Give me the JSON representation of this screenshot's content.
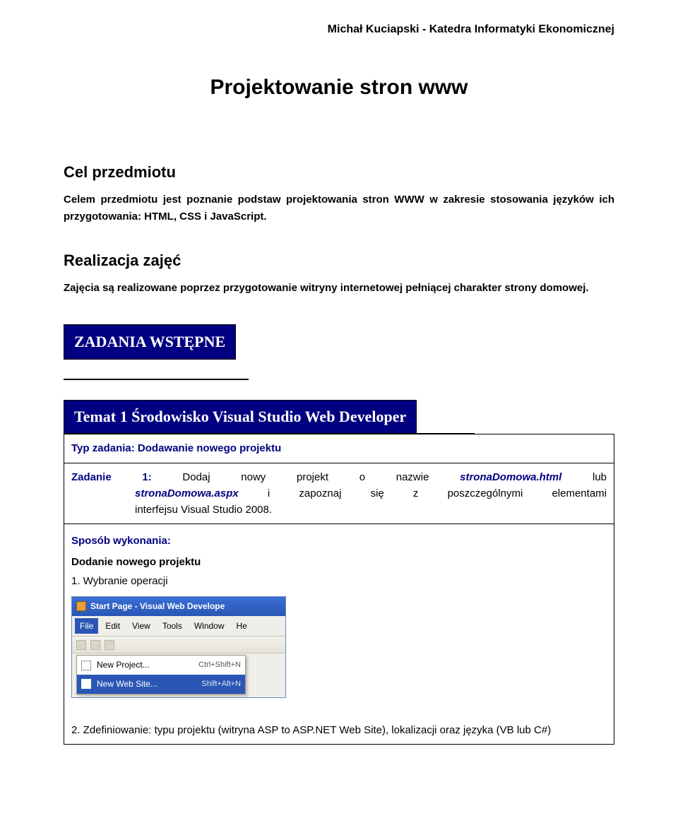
{
  "header": {
    "right": "Michał Kuciapski -  Katedra Informatyki Ekonomicznej"
  },
  "title": "Projektowanie stron www",
  "s1": {
    "heading": "Cel przedmiotu",
    "body": "Celem przedmiotu jest poznanie podstaw projektowania stron WWW w zakresie stosowania języków ich przygotowania: HTML, CSS i JavaScript."
  },
  "s2": {
    "heading": "Realizacja zajęć",
    "body": "Zajęcia są realizowane poprzez przygotowanie witryny internetowej pełniącej charakter strony domowej."
  },
  "box1": "ZADANIA WSTĘPNE",
  "box2": "Temat 1 Środowisko Visual Studio Web Developer",
  "task": {
    "type_label": "Typ zadania: ",
    "type_value": "Dodawanie nowego projektu",
    "zadanie_label": "Zadanie 1: ",
    "zadanie_pre": "Dodaj nowy projekt o nazwie ",
    "file1": "stronaDomowa.html",
    "mid1": " lub ",
    "file2": "stronaDomowa.aspx",
    "mid2": " i zapoznaj się z poszczególnymi elementami interfejsu Visual Studio 2008.",
    "method_label": "Sposób wykonania:",
    "sub1": "Dodanie nowego projektu",
    "step1": "1. Wybranie operacji"
  },
  "vs": {
    "title": "Start Page - Visual Web Develope",
    "menu": [
      "File",
      "Edit",
      "View",
      "Tools",
      "Window",
      "He"
    ],
    "dropdown": [
      {
        "label": "New Project...",
        "shortcut": "Ctrl+Shift+N"
      },
      {
        "label": "New Web Site...",
        "shortcut": "Shift+Alt+N"
      }
    ]
  },
  "bottom": {
    "prefix": "2. Zdefiniowanie: typu projektu (witryna ASP to  ASP.NET Web Site), lokalizacji oraz języka (VB lub C#)"
  }
}
